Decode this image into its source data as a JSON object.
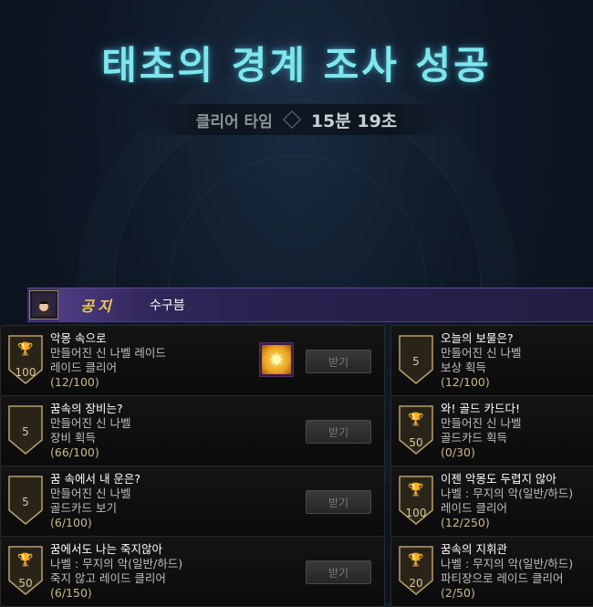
{
  "header": {
    "title": "태초의 경계 조사 성공",
    "clear_label": "클리어 타임",
    "clear_time": "15분 19초"
  },
  "notice": {
    "tag": "공지",
    "message": "수구븜"
  },
  "colors": {
    "title": "#7fe6ee",
    "notice_bg": "#2a2150",
    "notice_tag": "#f2c94c"
  },
  "achievements": [
    {
      "title": "악몽 속으로",
      "line1": "만들어진 신 나벨 레이드",
      "line2": "레이드 클리어",
      "progress": "(12/100)",
      "badge": "100",
      "trophy": "purple-trophy-icon",
      "button": "받기"
    },
    {
      "title": "오늘의 보물은?",
      "line1": "만들어진 신 나벨",
      "line2": "보상 획득",
      "progress": "(12/100)",
      "badge": "5",
      "trophy": "",
      "button": ""
    },
    {
      "title": "꿈속의 장비는?",
      "line1": "만들어진 신 나벨",
      "line2": "장비 획득",
      "progress": "(66/100)",
      "badge": "5",
      "trophy": "",
      "button": "받기"
    },
    {
      "title": "와! 골드 카드다!",
      "line1": "만들어진 신 나벨",
      "line2": "골드카드 획득",
      "progress": "(0/30)",
      "badge": "50",
      "trophy": "gold-trophy-icon",
      "button": ""
    },
    {
      "title": "꿈 속에서 내 운은?",
      "line1": "만들어진 신 나벨",
      "line2": "골드카드 보기",
      "progress": "(6/100)",
      "badge": "5",
      "trophy": "",
      "button": "받기"
    },
    {
      "title": "이젠 악몽도 두렵지 않아",
      "line1": "나벨 : 무지의 악(일반/하드)",
      "line2": "레이드 클리어",
      "progress": "(12/250)",
      "badge": "100",
      "trophy": "purple-trophy-icon",
      "button": ""
    },
    {
      "title": "꿈에서도 나는 죽지않아",
      "line1": "나벨 : 무지의 악(일반/하드)",
      "line2": "죽지 않고 레이드 클리어",
      "progress": "(6/150)",
      "badge": "50",
      "trophy": "gold-trophy-icon",
      "button": "받기"
    },
    {
      "title": "꿈속의 지휘관",
      "line1": "나벨 : 무지의 악(일반/하드)",
      "line2": "파티장으로 레이드 클리어",
      "progress": "(2/50)",
      "badge": "20",
      "trophy": "silver-trophy-icon",
      "button": ""
    }
  ]
}
